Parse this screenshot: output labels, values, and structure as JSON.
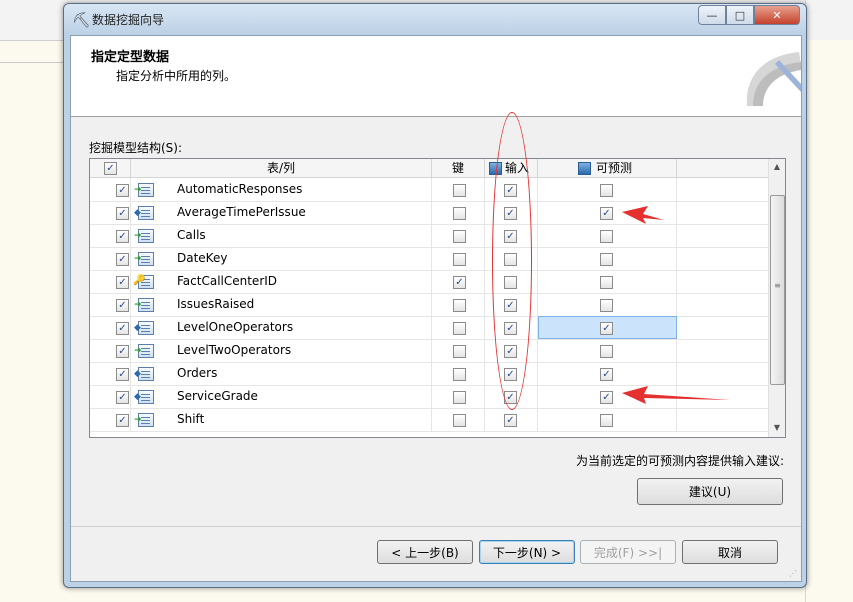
{
  "window": {
    "title": "数据挖掘向导",
    "buttons": {
      "minimize": "—",
      "maximize": "□",
      "close": "✕"
    }
  },
  "header": {
    "title": "指定定型数据",
    "subtitle": "指定分析中所用的列。"
  },
  "structure": {
    "label": "挖掘模型结构(S):",
    "columns": {
      "table_col": "表/列",
      "key": "键",
      "input": "输入",
      "predictable": "可预测"
    },
    "header_checks": {
      "all": true,
      "input": true,
      "predictable": true
    },
    "rows": [
      {
        "name": "AutomaticResponses",
        "icon": "input-column-icon",
        "included": true,
        "key": false,
        "input": true,
        "predictable": false
      },
      {
        "name": "AverageTimePerIssue",
        "icon": "predictable-column-icon",
        "included": true,
        "key": false,
        "input": true,
        "predictable": true
      },
      {
        "name": "Calls",
        "icon": "input-column-icon",
        "included": true,
        "key": false,
        "input": true,
        "predictable": false
      },
      {
        "name": "DateKey",
        "icon": "input-column-icon",
        "included": true,
        "key": false,
        "input": false,
        "predictable": false
      },
      {
        "name": "FactCallCenterID",
        "icon": "key-column-icon",
        "included": true,
        "key": true,
        "input": false,
        "predictable": false
      },
      {
        "name": "IssuesRaised",
        "icon": "input-column-icon",
        "included": true,
        "key": false,
        "input": true,
        "predictable": false
      },
      {
        "name": "LevelOneOperators",
        "icon": "predictable-column-icon",
        "included": true,
        "key": false,
        "input": true,
        "predictable": true,
        "selected": true
      },
      {
        "name": "LevelTwoOperators",
        "icon": "input-column-icon",
        "included": true,
        "key": false,
        "input": true,
        "predictable": false
      },
      {
        "name": "Orders",
        "icon": "predictable-column-icon",
        "included": true,
        "key": false,
        "input": true,
        "predictable": true
      },
      {
        "name": "ServiceGrade",
        "icon": "predictable-column-icon",
        "included": true,
        "key": false,
        "input": true,
        "predictable": true
      },
      {
        "name": "Shift",
        "icon": "input-column-icon",
        "included": true,
        "key": false,
        "input": true,
        "predictable": false
      }
    ]
  },
  "suggest": {
    "text": "为当前选定的可预测内容提供输入建议:",
    "button": "建议(U)"
  },
  "nav": {
    "back": "< 上一步(B)",
    "next": "下一步(N) >",
    "finish": "完成(F) >>|",
    "cancel": "取消"
  },
  "colors": {
    "annotation": "#e53030",
    "selection": "#cce4fb"
  }
}
